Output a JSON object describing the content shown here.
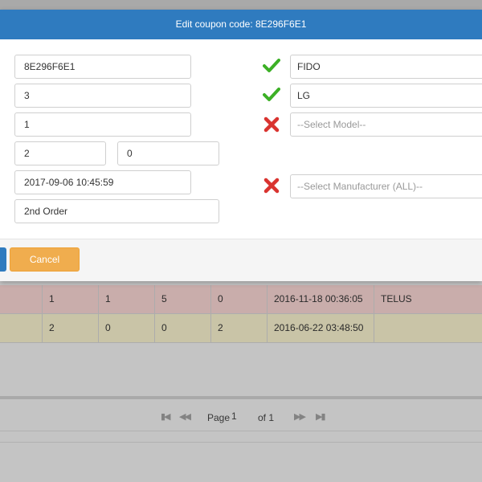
{
  "modal": {
    "title": "Edit coupon code: 8E296F6E1",
    "fields": {
      "code": "8E296F6E1",
      "field2": "3",
      "field3": "1",
      "field4a": "2",
      "field4b": "0",
      "datetime": "2017-09-06 10:45:59",
      "order": "2nd Order"
    },
    "right": {
      "carrier": {
        "value": "FIDO",
        "status": "valid"
      },
      "brand": {
        "value": "LG",
        "status": "valid"
      },
      "model": {
        "placeholder": "--Select Model--",
        "status": "invalid"
      },
      "manufacturer": {
        "placeholder": "--Select Manufacturer (ALL)--",
        "status": "invalid"
      }
    },
    "footer": {
      "cancel_label": "Cancel"
    }
  },
  "grid": {
    "rows": [
      {
        "c1": "1",
        "c2": "1",
        "c3": "5",
        "c4": "0",
        "date": "2016-11-18 00:36:05",
        "carrier": "TELUS",
        "status_color": "#f6d4d1"
      },
      {
        "c1": "2",
        "c2": "0",
        "c3": "0",
        "c4": "2",
        "date": "2016-06-22 03:48:50",
        "carrier": "",
        "status_color": "#f6f0cc"
      }
    ],
    "pager": {
      "page_label": "Page",
      "page_value": "1",
      "of_label": "of 1"
    }
  },
  "colors": {
    "header": "#2f7bbf",
    "cancel": "#f0ad4e",
    "valid": "#3cb026",
    "invalid": "#d9332f"
  }
}
